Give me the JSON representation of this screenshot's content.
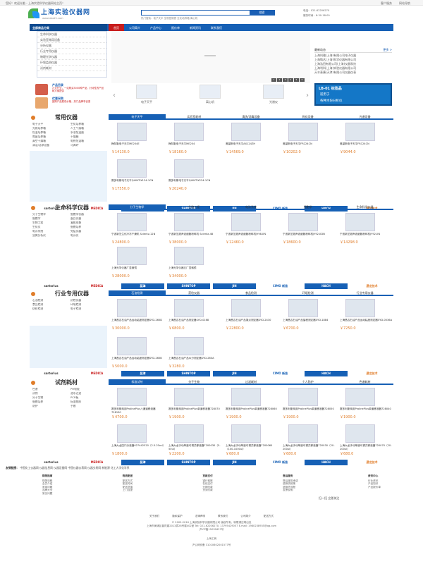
{
  "topbar": {
    "welcome": "您好！欢迎光临 - 上海实验科学仪器网站主页！",
    "links": [
      "客户服务",
      "网站导航"
    ]
  },
  "logo": {
    "name": "上海实验仪器网",
    "url": "www.labs21.com"
  },
  "search": {
    "button": "搜索",
    "placeholder": "",
    "hot": "热门搜索：电子天平  生物显微镜  生化培养箱  离心机"
  },
  "contact": {
    "phone": "电话：021-62206270",
    "hours": "服务时间：8:30-18:00"
  },
  "nav": {
    "category": "全部商品分类",
    "items": [
      "首页",
      "公司简介",
      "产品中心",
      "报价单",
      "新闻资讯",
      "联系我们"
    ]
  },
  "categories": [
    "生命科学仪器",
    "实验室常用设备",
    "分析仪器",
    "行业专用仪器",
    "物理光学仪器",
    "环境监测仪器",
    "试剂耗材"
  ],
  "news": {
    "title": "最新动态",
    "more": "更多 >",
    "items": [
      "上海科雅(上海)有限公司电子仪器",
      "上海铸达(上海)科学仪器有限公司",
      "上海浩田有限公司(上海)仪器科技",
      "上海利科(上海)实验仪器有限公司",
      "天丰泰康(天津)有限公司仪器仪表"
    ]
  },
  "banner": {
    "pages": [
      "1",
      "2",
      "3",
      "4",
      "5",
      "6"
    ]
  },
  "promo": [
    {
      "title": "产品目录",
      "desc": "六大行业，一站购买5000种产品，针对性的产品和方案提供"
    },
    {
      "title": "优惠采购",
      "desc": "团购产品更低价格，热门品牌享优惠"
    }
  ],
  "carousel": {
    "items": [
      "电子天平",
      "离心机",
      "光谱仪"
    ],
    "prev": "‹",
    "next": "›"
  },
  "ad": {
    "l1": "LB-01 标签品",
    "l2": "适用于",
    "l3": "各种水份分析仪"
  },
  "sections": [
    {
      "title": "常用仪器",
      "tabs": [
        "电子天平",
        "实验室耗材",
        "清洗/消毒设备",
        "称化设备",
        "光谱设备"
      ],
      "links": [
        "电子天平",
        "生化培养箱",
        "光照培养箱",
        "人工气候箱",
        "恒温培养箱",
        "水浴恒温器",
        "霉菌培养箱",
        "干燥箱",
        "真空干燥箱",
        "电热恒温箱",
        "清洁/洁净设备",
        "马弗炉"
      ],
      "products": [
        {
          "name": "梅特勒电子天平ME204E",
          "price": "￥14130.0"
        },
        {
          "name": "梅特勒电子天平ME204",
          "price": "￥18160.0"
        },
        {
          "name": "奥豪斯电子天平AX124ZH",
          "price": "￥14569.0"
        },
        {
          "name": "奥豪斯电子天平FR224CN",
          "price": "￥10202.0"
        },
        {
          "name": "奥豪斯电子天平FR124CN",
          "price": "￥9044.0"
        },
        {
          "name": "赛多利斯电子天平QUINTIX124-1CN",
          "price": "￥17550.0"
        },
        {
          "name": "赛多利斯电子天平QUINTIX224-1CN",
          "price": "￥20240.0"
        }
      ]
    },
    {
      "title": "生命科学仪器",
      "tabs": [
        "分子生物学",
        "生物工程",
        "电泳系统",
        "细胞学",
        "生命科学仪器"
      ],
      "links": [
        "分子生物学",
        "细胞学仪器",
        "细胞学",
        "蛋白仪器",
        "生物工程",
        "凝胶成像",
        "生化仪",
        "细胞培养",
        "电泳系统",
        "免疫仪器",
        "显微分析仪",
        "电泳仪"
      ],
      "products": [
        {
          "name": "宁波新芝生化冷冻干燥机 Scientz-12N",
          "price": "￥24800.0"
        },
        {
          "name": "宁波新芝超声波细胞粉碎机 Scientz-48",
          "price": "￥38000.0"
        },
        {
          "name": "宁波新芝超声波细胞粉碎机JY98-IIN",
          "price": "￥12460.0"
        },
        {
          "name": "宁波新芝超声波细胞粉碎机JY92-IIDN",
          "price": "￥18600.0"
        },
        {
          "name": "宁波新芝超声波细胞粉碎机JY92-IIN",
          "price": "￥14298.0"
        },
        {
          "name": "上海光学仪器厂显微镜",
          "price": "￥28000.0"
        },
        {
          "name": "上海光学仪器五厂显微镜",
          "price": "￥34000.0"
        }
      ]
    },
    {
      "title": "行业专用仪器",
      "tabs": [
        "石油检测",
        "药检仪器",
        "食品检测",
        "环境检测",
        "行业专用仪器"
      ],
      "links": [
        "石油检测",
        "药检仪器",
        "食品检测",
        "环境检测",
        "纺织检测",
        "电子检测"
      ],
      "products": [
        {
          "name": "上海昌吉石油产品运动粘度测定器SYD-265D",
          "price": "￥30000.0"
        },
        {
          "name": "上海昌吉石油产品测定器SYD-0168",
          "price": "￥6800.0"
        },
        {
          "name": "上海昌吉石油产品凝点测定器SYD-2430",
          "price": "￥22800.0"
        },
        {
          "name": "上海昌吉石油产品馏程测定器SYD-1884",
          "price": "￥6700.0"
        },
        {
          "name": "上海昌吉石油产品运动粘度测定器SYD-0536A",
          "price": "￥7250.0"
        },
        {
          "name": "上海昌吉石油产品运动粘度测定器SYD-265B",
          "price": "￥5000.0"
        },
        {
          "name": "上海昌吉石油产品水分测定器SYD-260A",
          "price": "￥3280.0"
        }
      ]
    },
    {
      "title": "试剂耗材",
      "tabs": [
        "标准试剂",
        "分子生物",
        "过滤耗材",
        "个人防护",
        "色谱耗材"
      ],
      "links": [
        "色谱",
        "PH电极",
        "试剂",
        "滤水过滤",
        "分子生物",
        "PCR板",
        "细胞培养",
        "标准物质",
        "防护",
        "手套"
      ],
      "products": [
        {
          "name": "赛多利斯商用ProlinePlus八通道移液器728130",
          "price": "￥4700.0"
        },
        {
          "name": "赛多利斯商用ProlinePlus单道移液器728070",
          "price": "￥1900.0"
        },
        {
          "name": "赛多利斯商用ProlinePlus单道移液器728060",
          "price": "￥1900.0"
        },
        {
          "name": "赛多利斯商用ProlinePlus单道移液器728050",
          "price": "￥1900.0"
        },
        {
          "name": "赛多利斯商用ProlinePlus单道移液器728040",
          "price": "￥1900.0"
        },
        {
          "name": "上海大龙四口分液器027442520（2.5-25ml）",
          "price": "￥1800.0"
        },
        {
          "name": "上海大龙手动单道可调式移液器7200030（5-50ul）",
          "price": "￥2200.0"
        },
        {
          "name": "上海大龙手动单道可调式移液器7200060（100-1000ul）",
          "price": "￥680.0"
        },
        {
          "name": "上海大龙手动单道可调式移液器720030（20-200ul）",
          "price": "￥680.0"
        },
        {
          "name": "上海大龙手动单道可调式移液器720070（20-200ul）",
          "price": "￥680.0"
        }
      ]
    }
  ],
  "brands": [
    "sartorius",
    "MEDICA",
    "蕊津",
    "SHINTOP",
    "JIN",
    "CIMO 新苗",
    "HACH",
    "晟龙技术"
  ],
  "friendlinks": {
    "label": "友情链接：",
    "text": "中国化工仪器网  仪器信息网  仪器设备网  中国仪器仪表网  仪器交易网  新能源  化工大学化学系"
  },
  "footcols": [
    {
      "h": "购物指南",
      "items": [
        "购物流程",
        "会员介绍",
        "常用问题",
        "品牌大全",
        "常见问题"
      ]
    },
    {
      "h": "物流配送",
      "items": [
        "配送方式",
        "配送时间",
        "配送范围",
        "上门自提"
      ]
    },
    {
      "h": "货款支付",
      "items": [
        "银行转账",
        "在线支付",
        "分期付款",
        "货到付款"
      ]
    },
    {
      "h": "售后服务",
      "items": [
        "售后服务承诺",
        "退换货政策",
        "退换货流程",
        "发票说明"
      ]
    },
    {
      "h": "资讯中心",
      "items": [
        "行业资讯",
        "产品知识",
        "产品报价单"
      ]
    }
  ],
  "online": "扫一扫  立即关注",
  "footer": {
    "nav": [
      "关于我们",
      "隐私保护",
      "法律声明",
      "联系我们",
      "公司简介",
      "配送方式"
    ],
    "l1": "© 2005-2016 上海实验科学仪器有限公司  版权所有，转载请注明出处",
    "l2": "上海市黄浦区普陀路2013弄28号楼402室  Tel: 021-62206270, 13795429057  E-mail: 1980238935@qq.com",
    "l3": "沪ICP备15032627号",
    "l4": "上海工商",
    "l5": "沪公网安备 31010602001577号"
  }
}
